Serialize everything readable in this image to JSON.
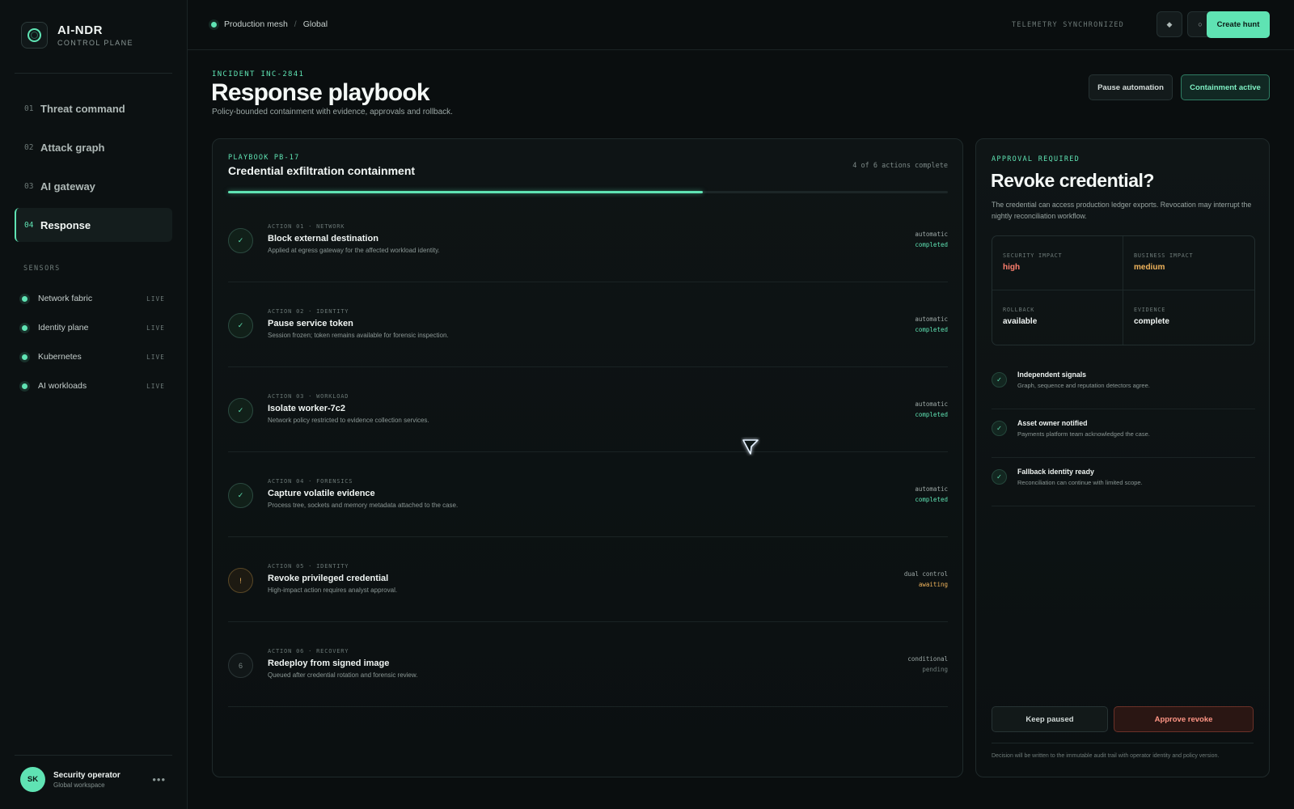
{
  "brand": {
    "title": "AI-NDR",
    "subtitle": "CONTROL PLANE"
  },
  "nav": [
    {
      "num": "01",
      "label": "Threat command"
    },
    {
      "num": "02",
      "label": "Attack graph"
    },
    {
      "num": "03",
      "label": "AI gateway"
    },
    {
      "num": "04",
      "label": "Response",
      "active": true
    }
  ],
  "sensors": {
    "title": "SENSORS",
    "items": [
      {
        "name": "Network fabric",
        "status": "LIVE"
      },
      {
        "name": "Identity plane",
        "status": "LIVE"
      },
      {
        "name": "Kubernetes",
        "status": "LIVE"
      },
      {
        "name": "AI workloads",
        "status": "LIVE"
      }
    ]
  },
  "user": {
    "initials": "SK",
    "name": "Security operator",
    "workspace": "Global workspace",
    "more": "•••"
  },
  "topbar": {
    "breadcrumb": [
      "Production mesh",
      "Global"
    ],
    "separator": "/",
    "telemetry": "TELEMETRY SYNCHRONIZED",
    "icon1": "◆",
    "icon2": "○",
    "create_hunt": "Create hunt"
  },
  "header": {
    "incident": "INCIDENT INC-2841",
    "title": "Response playbook",
    "subtitle": "Policy-bounded containment with evidence, approvals and rollback.",
    "pause": "Pause automation",
    "containment": "Containment active"
  },
  "playbook": {
    "code": "PLAYBOOK PB-17",
    "title": "Credential exfiltration containment",
    "count": "4 of 6 actions complete",
    "progress": 0.66,
    "actions": [
      {
        "icon": "✓",
        "meta": "ACTION 01 · NETWORK",
        "name": "Block external destination",
        "desc": "Applied at egress gateway for the affected workload identity.",
        "mode": "automatic",
        "state": "completed",
        "kind": "done"
      },
      {
        "icon": "✓",
        "meta": "ACTION 02 · IDENTITY",
        "name": "Pause service token",
        "desc": "Session frozen; token remains available for forensic inspection.",
        "mode": "automatic",
        "state": "completed",
        "kind": "done"
      },
      {
        "icon": "✓",
        "meta": "ACTION 03 · WORKLOAD",
        "name": "Isolate worker-7c2",
        "desc": "Network policy restricted to evidence collection services.",
        "mode": "automatic",
        "state": "completed",
        "kind": "done"
      },
      {
        "icon": "✓",
        "meta": "ACTION 04 · FORENSICS",
        "name": "Capture volatile evidence",
        "desc": "Process tree, sockets and memory metadata attached to the case.",
        "mode": "automatic",
        "state": "completed",
        "kind": "done"
      },
      {
        "icon": "!",
        "meta": "ACTION 05 · IDENTITY",
        "name": "Revoke privileged credential",
        "desc": "High-impact action requires analyst approval.",
        "mode": "dual control",
        "state": "awaiting",
        "kind": "warn"
      },
      {
        "icon": "6",
        "meta": "ACTION 06 · RECOVERY",
        "name": "Redeploy from signed image",
        "desc": "Queued after credential rotation and forensic review.",
        "mode": "conditional",
        "state": "pending",
        "kind": "pending"
      }
    ]
  },
  "approval": {
    "tag": "APPROVAL REQUIRED",
    "title": "Revoke credential?",
    "description": "The credential can access production ledger exports. Revocation may interrupt the nightly reconciliation workflow.",
    "impacts": [
      {
        "label": "SECURITY IMPACT",
        "value": "high",
        "tone": "red"
      },
      {
        "label": "BUSINESS IMPACT",
        "value": "medium",
        "tone": "amber"
      },
      {
        "label": "ROLLBACK",
        "value": "available",
        "tone": "plain"
      },
      {
        "label": "EVIDENCE",
        "value": "complete",
        "tone": "plain"
      }
    ],
    "checks": [
      {
        "title": "Independent signals",
        "desc": "Graph, sequence and reputation detectors agree."
      },
      {
        "title": "Asset owner notified",
        "desc": "Payments platform team acknowledged the case."
      },
      {
        "title": "Fallback identity ready",
        "desc": "Reconciliation can continue with limited scope."
      }
    ],
    "check_icon": "✓",
    "keep": "Keep paused",
    "approve": "Approve revoke",
    "footnote": "Decision will be written to the immutable audit trail with operator identity and policy version."
  },
  "colors": {
    "accent": "#5fe3b3",
    "warn": "#f0b45c",
    "danger": "#ff7f6e",
    "background": "#0a0e0f"
  }
}
